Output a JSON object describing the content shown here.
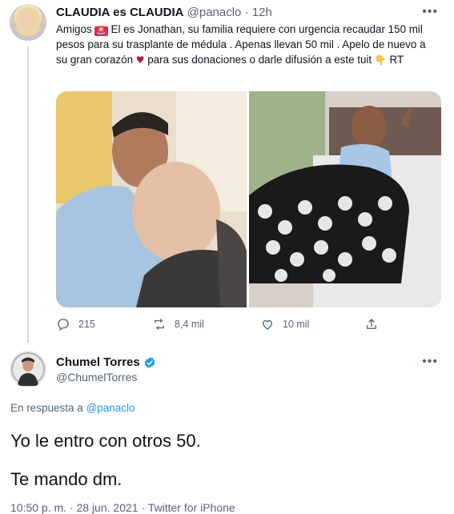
{
  "tweet1": {
    "display_name": "CLAUDIA es CLAUDIA",
    "handle": "@panaclo",
    "separator": "·",
    "time": "12h",
    "more": "•••",
    "text_part1": "Amigos ",
    "emoji_siren": "🚨",
    "text_part2": " El es Jonathan, su familia requiere con urgencia recaudar 150 mil pesos para su trasplante de médula . Apenas llevan 50 mil . Apelo de nuevo a su gran corazón ",
    "emoji_heart": "♥",
    "text_part3": " para sus donaciones  o darle difusión a este tuit ",
    "emoji_hand": "👇",
    "text_part4": " RT",
    "actions": {
      "replies": "215",
      "retweets": "8,4 mil",
      "likes": "10 mil"
    }
  },
  "tweet2": {
    "display_name": "Chumel Torres",
    "handle": "@ChumelTorres",
    "more": "•••",
    "reply_prefix": "En respuesta a ",
    "reply_handle": "@panaclo",
    "line1": "Yo le entro con otros 50.",
    "line2": "Te mando dm.",
    "footer": "10:50 p. m. · 28 jun. 2021 · Twitter for iPhone"
  },
  "colors": {
    "accent": "#1d9bf0",
    "muted_text": "#536471",
    "primary_text": "#0f1419",
    "verified": "#1d9bf0"
  },
  "icons": [
    "reply-icon",
    "retweet-icon",
    "like-icon",
    "share-icon",
    "verified-badge-icon",
    "more-icon"
  ]
}
